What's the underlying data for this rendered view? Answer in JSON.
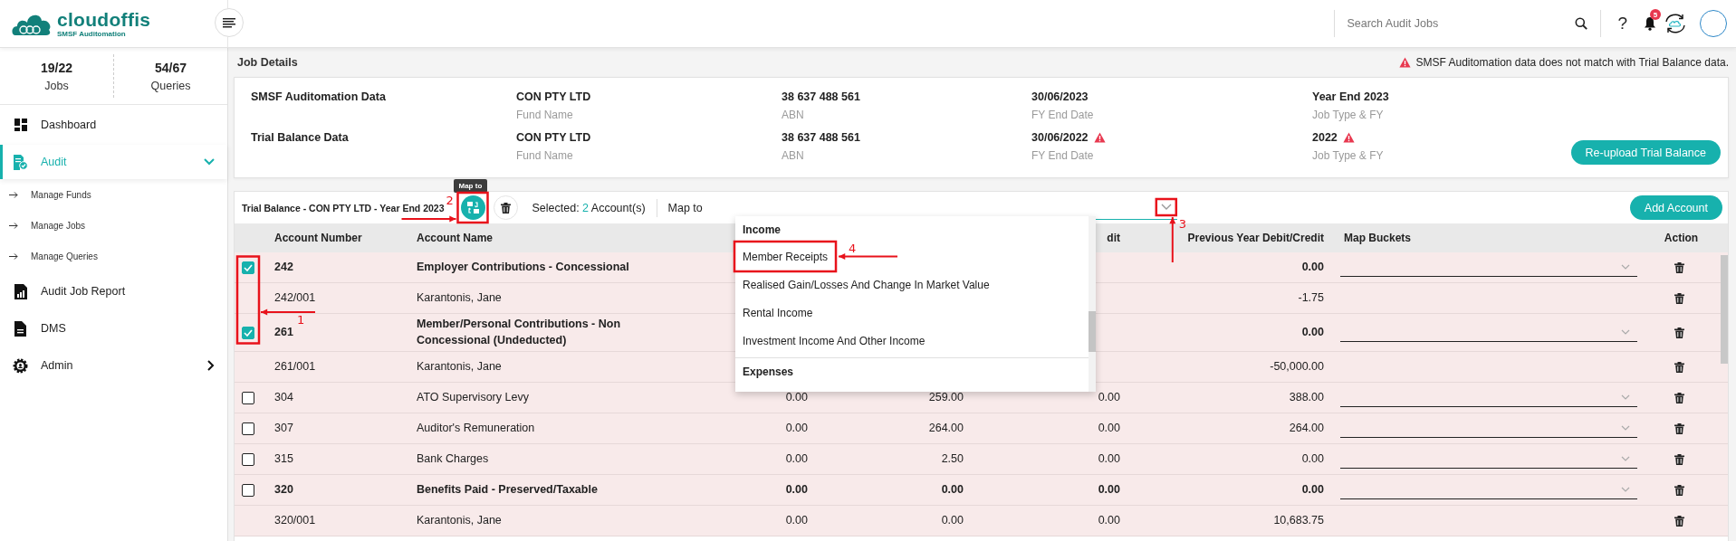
{
  "header": {
    "logo": {
      "name": "cloudoffis",
      "tagline": "SMSF Auditomation"
    },
    "search": {
      "placeholder": "Search Audit Jobs"
    },
    "help": "?",
    "notifications": {
      "count": "5"
    }
  },
  "sidebar": {
    "stats": [
      {
        "value": "19/22",
        "label": "Jobs"
      },
      {
        "value": "54/67",
        "label": "Queries"
      }
    ],
    "items": [
      {
        "label": "Dashboard",
        "selected": false
      },
      {
        "label": "Audit",
        "selected": true,
        "expanded": true,
        "children": [
          {
            "label": "Manage Funds"
          },
          {
            "label": "Manage Jobs"
          },
          {
            "label": "Manage Queries"
          }
        ]
      },
      {
        "label": "Audit Job Report",
        "selected": false
      },
      {
        "label": "DMS",
        "selected": false
      },
      {
        "label": "Admin",
        "selected": false,
        "expanded": false
      }
    ]
  },
  "job_details": {
    "title": "Job Details",
    "alert": "SMSF Auditomation data does not match with Trial Balance data.",
    "reupload_button": "Re-upload Trial Balance",
    "rows": [
      {
        "label": "SMSF Auditomation Data",
        "fields": [
          {
            "value": "CON PTY LTD",
            "caption": "Fund Name",
            "warning": false
          },
          {
            "value": "38 637 488 561",
            "caption": "ABN",
            "warning": false
          },
          {
            "value": "30/06/2023",
            "caption": "FY End Date",
            "warning": false
          },
          {
            "value": "Year End 2023",
            "caption": "Job Type & FY",
            "warning": false
          }
        ]
      },
      {
        "label": "Trial Balance Data",
        "fields": [
          {
            "value": "CON PTY LTD",
            "caption": "Fund Name",
            "warning": false
          },
          {
            "value": "38 637 488 561",
            "caption": "ABN",
            "warning": false
          },
          {
            "value": "30/06/2022",
            "caption": "FY End Date",
            "warning": true
          },
          {
            "value": "2022",
            "caption": "Job Type & FY",
            "warning": true
          }
        ]
      }
    ]
  },
  "trial_balance": {
    "title": "Trial Balance - CON PTY LTD - Year End 2023",
    "tooltip": "Map to",
    "selected_label": "Selected:",
    "selected_count": "2",
    "selected_unit": "Account(s)",
    "map_to_label": "Map to",
    "add_button": "Add Account",
    "dropdown": {
      "expanded": true,
      "groups": [
        {
          "label": "Income",
          "items": [
            {
              "label": "Member Receipts"
            },
            {
              "label": "Realised Gain/Losses And Change In Market Value"
            },
            {
              "label": "Rental Income"
            },
            {
              "label": "Investment Income And Other Income"
            }
          ]
        },
        {
          "label": "Expenses"
        }
      ]
    },
    "columns": {
      "account_number": "Account Number",
      "account_name": "Account Name",
      "column_5": "dit",
      "previous_year": "Previous Year Debit/Credit",
      "map_buckets": "Map Buckets",
      "action": "Action"
    },
    "rows": [
      {
        "kind": "group",
        "number": "242",
        "name": "Employer Contributions - Concessional",
        "checked": true,
        "previous": "0.00"
      },
      {
        "kind": "member",
        "number": "242/001",
        "name": "Karantonis, Jane",
        "previous": "-1.75"
      },
      {
        "kind": "group",
        "number": "261",
        "name": "Member/Personal Contributions - Non Concessional (Undeducted)",
        "checked": true,
        "previous": "0.00"
      },
      {
        "kind": "member",
        "number": "261/001",
        "name": "Karantonis, Jane",
        "previous": "-50,000.00"
      },
      {
        "kind": "account",
        "number": "304",
        "name": "ATO Supervisory Levy",
        "checked": false,
        "debit": "0.00",
        "credit": "259.00",
        "column_5": "0.00",
        "previous": "388.00"
      },
      {
        "kind": "account",
        "number": "307",
        "name": "Auditor's Remuneration",
        "checked": false,
        "debit": "0.00",
        "credit": "264.00",
        "column_5": "0.00",
        "previous": "264.00"
      },
      {
        "kind": "account",
        "number": "315",
        "name": "Bank Charges",
        "checked": false,
        "debit": "0.00",
        "credit": "2.50",
        "column_5": "0.00",
        "previous": "0.00"
      },
      {
        "kind": "group",
        "number": "320",
        "name": "Benefits Paid - Preserved/Taxable",
        "checked": false,
        "debit": "0.00",
        "credit": "0.00",
        "column_5": "0.00",
        "previous": "0.00"
      },
      {
        "kind": "member",
        "number": "320/001",
        "name": "Karantonis, Jane",
        "debit": "0.00",
        "credit": "0.00",
        "column_5": "0.00",
        "previous": "10,683.75"
      }
    ]
  },
  "annotations": [
    {
      "number": "1"
    },
    {
      "number": "2"
    },
    {
      "number": "3"
    },
    {
      "number": "4"
    }
  ]
}
